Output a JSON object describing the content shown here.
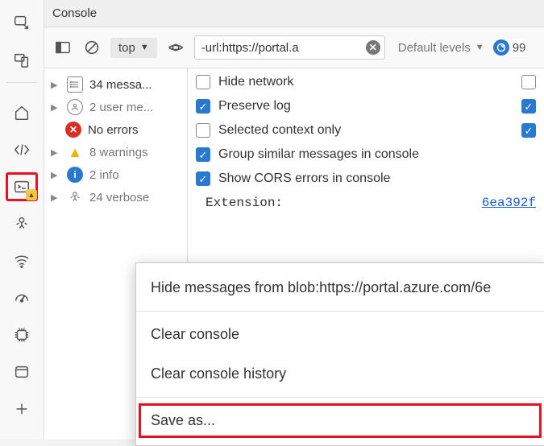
{
  "title": "Console",
  "toolbar": {
    "context": "top",
    "filter_value": "-url:https://portal.a",
    "levels_label": "Default levels",
    "issue_count": "99"
  },
  "filters": {
    "all": "34 messa...",
    "user": "2 user me...",
    "errors": "No errors",
    "warnings": "8 warnings",
    "info": "2 info",
    "verbose": "24 verbose"
  },
  "settings": {
    "hide_network": "Hide network",
    "preserve_log": "Preserve log",
    "selected_context": "Selected context only",
    "group_similar": "Group similar messages in console",
    "show_cors": "Show CORS errors in console"
  },
  "extension": {
    "label": "Extension:",
    "hash": "6ea392f"
  },
  "context_menu": {
    "hide_messages": "Hide messages from blob:https://portal.azure.com/6e",
    "clear_console": "Clear console",
    "clear_history": "Clear console history",
    "save_as": "Save as..."
  }
}
